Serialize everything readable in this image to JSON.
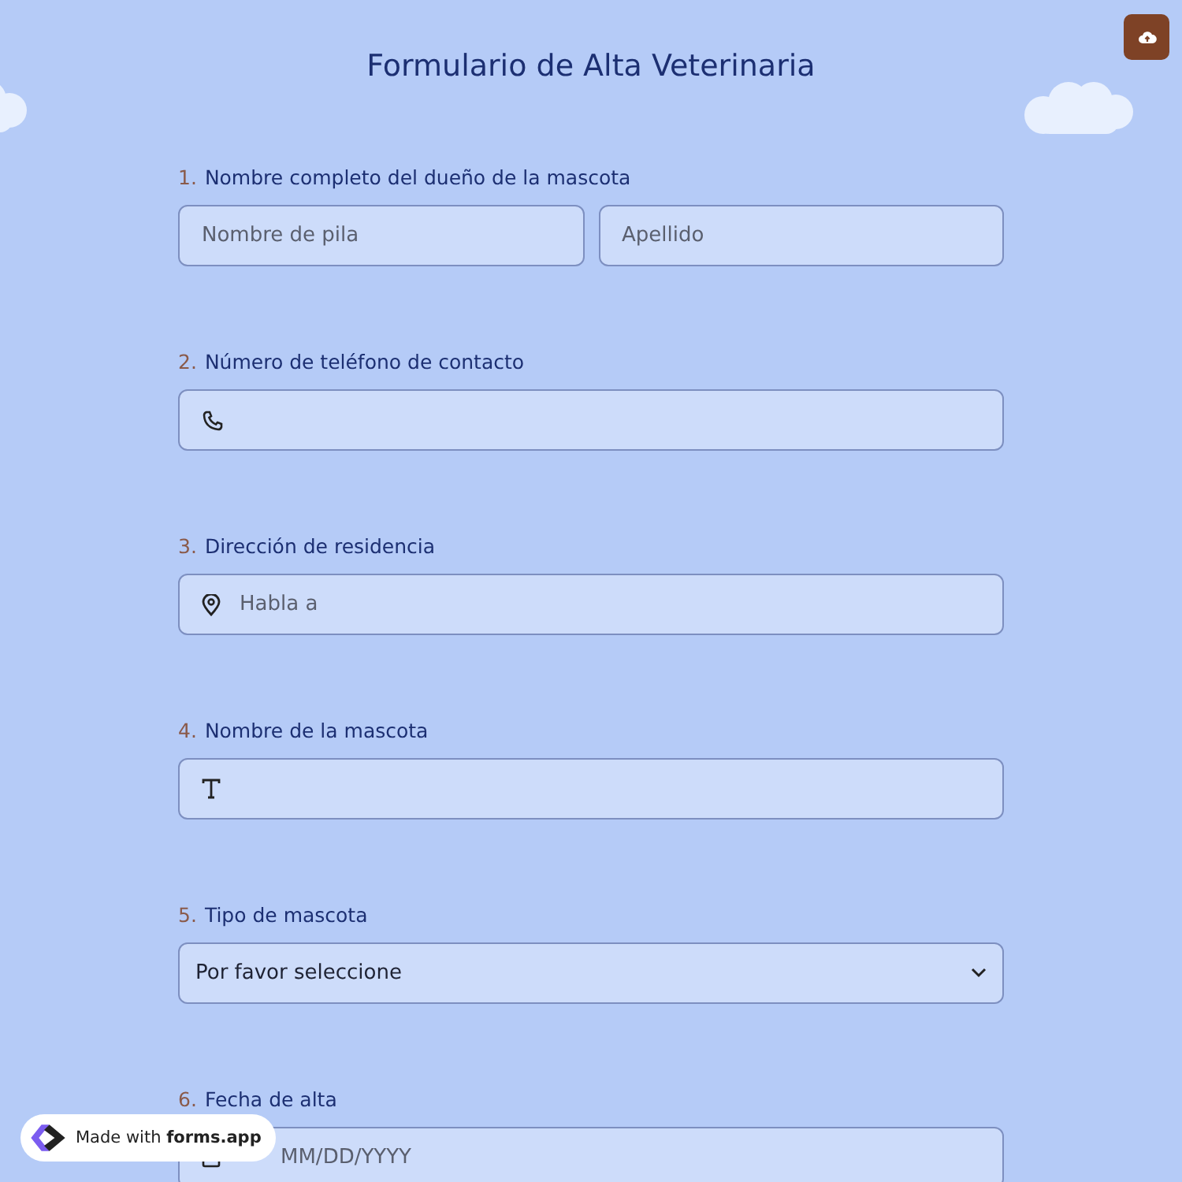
{
  "title": "Formulario de Alta Veterinaria",
  "questions": [
    {
      "number": "1.",
      "label": "Nombre completo del dueño de la mascota",
      "kind": "name",
      "fields": [
        {
          "placeholder": "Nombre de pila"
        },
        {
          "placeholder": "Apellido"
        }
      ]
    },
    {
      "number": "2.",
      "label": "Número de teléfono de contacto",
      "kind": "phone"
    },
    {
      "number": "3.",
      "label": "Dirección de residencia",
      "kind": "address",
      "placeholder": "Habla a"
    },
    {
      "number": "4.",
      "label": "Nombre de la mascota",
      "kind": "text"
    },
    {
      "number": "5.",
      "label": "Tipo de mascota",
      "kind": "select",
      "value": "Por favor seleccione"
    },
    {
      "number": "6.",
      "label": "Fecha de alta",
      "kind": "date",
      "placeholder": "MM/DD/YYYY"
    }
  ],
  "badge": "Made with **forms.app**"
}
